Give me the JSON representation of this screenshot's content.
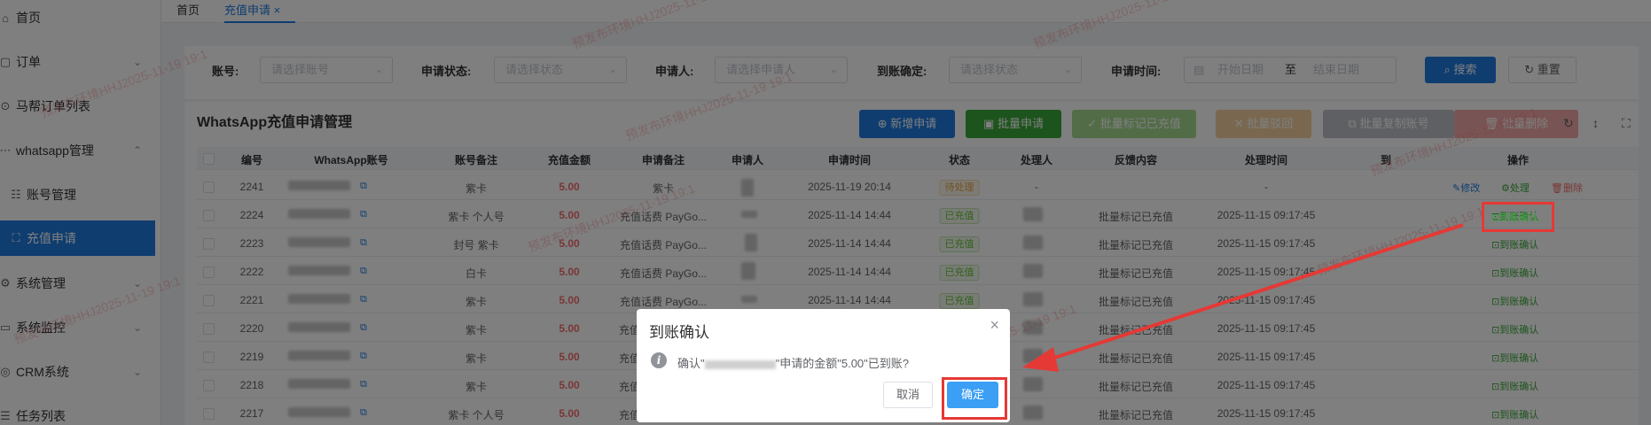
{
  "sidebar": {
    "items": [
      {
        "label": "首页",
        "icon": "home-icon"
      },
      {
        "label": "订单",
        "icon": "order-icon"
      },
      {
        "label": "马帮订单列表",
        "icon": "list-icon"
      },
      {
        "label": "whatsapp管理",
        "icon": "chat-icon"
      },
      {
        "label": "账号管理",
        "icon": "user-icon"
      },
      {
        "label": "充值申请",
        "icon": "recharge-icon"
      },
      {
        "label": "系统管理",
        "icon": "gear-icon"
      },
      {
        "label": "系统监控",
        "icon": "monitor-icon"
      },
      {
        "label": "CRM系统",
        "icon": "crm-icon"
      },
      {
        "label": "任务列表",
        "icon": "task-icon"
      }
    ]
  },
  "tabs": {
    "home": "首页",
    "active": "充值申请",
    "close": "×"
  },
  "search": {
    "account_label": "账号:",
    "account_placeholder": "请选择账号",
    "status_label": "申请状态:",
    "status_placeholder": "请选择状态",
    "applicant_label": "申请人:",
    "applicant_placeholder": "请选择申请人",
    "confirm_label": "到账确定:",
    "confirm_placeholder": "请选择状态",
    "time_label": "申请时间:",
    "start_placeholder": "开始日期",
    "range_sep": "至",
    "end_placeholder": "结束日期",
    "search_btn": "搜索",
    "reset_btn": "重置"
  },
  "card": {
    "title": "WhatsApp充值申请管理",
    "add_btn": "新增申请",
    "batch_apply_btn": "批量申请",
    "batch_mark_btn": "批量标记已充值",
    "batch_reject_btn": "批量驳回",
    "batch_copy_btn": "批量复制账号",
    "batch_delete_btn": "批量删除"
  },
  "table": {
    "headers": {
      "id": "编号",
      "account": "WhatsApp账号",
      "account_note": "账号备注",
      "amount": "充值金额",
      "apply_note": "申请备注",
      "applicant": "申请人",
      "apply_time": "申请时间",
      "status": "状态",
      "handler": "处理人",
      "feedback": "反馈内容",
      "handle_time": "处理时间",
      "arrival": "到",
      "action": "操作"
    },
    "rows": [
      {
        "id": "2241",
        "note": "紫卡",
        "amount": "5.00",
        "apply_note": "紫卡",
        "time": "2025-11-19 20:14",
        "status": "待处理",
        "handler": "-",
        "feedback": "",
        "handle_time": "-",
        "edit": "修改",
        "process": "处理",
        "delete": "删除"
      },
      {
        "id": "2224",
        "note": "紫卡 个人号",
        "amount": "5.00",
        "apply_note": "充值话费 PayGo...",
        "time": "2025-11-14 14:44",
        "status": "已充值",
        "handler": "",
        "feedback": "批量标记已充值",
        "handle_time": "2025-11-15 09:17:45",
        "confirm": "到账确认"
      },
      {
        "id": "2223",
        "note": "封号 紫卡",
        "amount": "5.00",
        "apply_note": "充值话费 PayGo...",
        "time": "2025-11-14 14:44",
        "status": "已充值",
        "handler": "",
        "feedback": "批量标记已充值",
        "handle_time": "2025-11-15 09:17:45",
        "confirm": "到账确认"
      },
      {
        "id": "2222",
        "note": "白卡",
        "amount": "5.00",
        "apply_note": "充值话费 PayGo...",
        "time": "2025-11-14 14:44",
        "status": "已充值",
        "handler": "",
        "feedback": "批量标记已充值",
        "handle_time": "2025-11-15 09:17:45",
        "confirm": "到账确认"
      },
      {
        "id": "2221",
        "note": "紫卡",
        "amount": "5.00",
        "apply_note": "充值话费 PayGo...",
        "time": "2025-11-14 14:44",
        "status": "已充值",
        "handler": "",
        "feedback": "批量标记已充值",
        "handle_time": "2025-11-15 09:17:45",
        "confirm": "到账确认"
      },
      {
        "id": "2220",
        "note": "紫卡",
        "amount": "5.00",
        "apply_note": "充值",
        "time": "",
        "status": "",
        "handler": "",
        "feedback": "批量标记已充值",
        "handle_time": "2025-11-15 09:17:45",
        "confirm": "到账确认"
      },
      {
        "id": "2219",
        "note": "紫卡",
        "amount": "5.00",
        "apply_note": "充值",
        "time": "",
        "status": "",
        "handler": "",
        "feedback": "批量标记已充值",
        "handle_time": "2025-11-15 09:17:45",
        "confirm": "到账确认"
      },
      {
        "id": "2218",
        "note": "紫卡",
        "amount": "5.00",
        "apply_note": "充值",
        "time": "",
        "status": "",
        "handler": "",
        "feedback": "批量标记已充值",
        "handle_time": "2025-11-15 09:17:45",
        "confirm": "到账确认"
      },
      {
        "id": "2217",
        "note": "紫卡 个人号",
        "amount": "5.00",
        "apply_note": "充值",
        "time": "",
        "status": "",
        "handler": "",
        "feedback": "批量标记已充值",
        "handle_time": "2025-11-15 09:17:45",
        "confirm": "到账确认"
      }
    ]
  },
  "dialog": {
    "title": "到账确认",
    "message_prefix": "确认\"",
    "message_suffix": "\"申请的金额\"5.00\"已到账?",
    "cancel": "取消",
    "confirm": "确定"
  },
  "watermark": "预发布环境HHJ2025-11-19 19:1",
  "colors": {
    "primary": "#1f7ae0",
    "success": "#67c23a",
    "warning": "#e6a23c",
    "danger": "#f56c6c",
    "annotation": "#e53935"
  }
}
